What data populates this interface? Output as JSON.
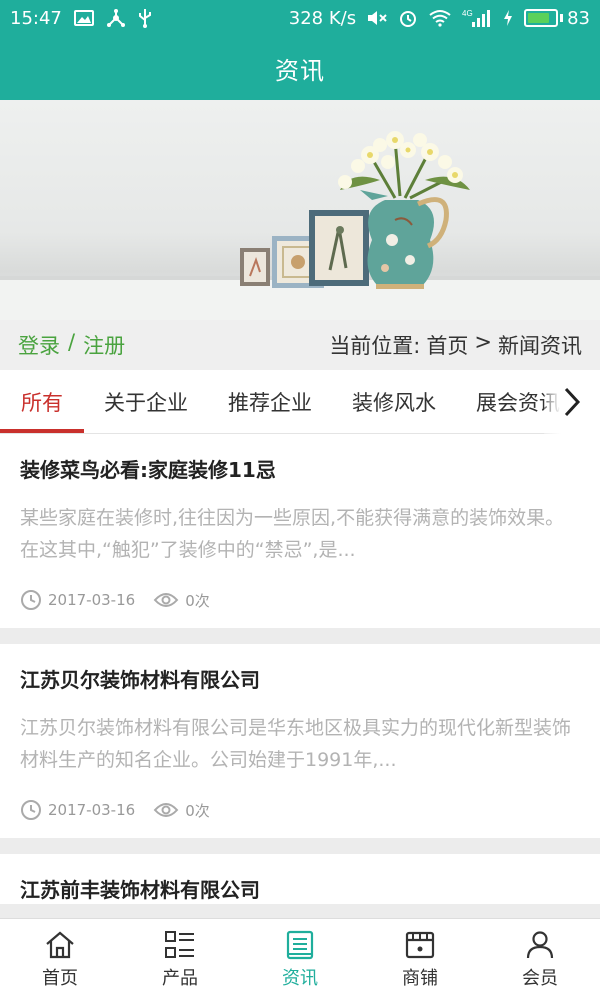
{
  "status_bar": {
    "time": "15:47",
    "net_speed": "328 K/s",
    "network_type": "4G",
    "battery": "83",
    "battery_level": 0.83,
    "icons": [
      "photo-icon",
      "usb-share-icon",
      "usb-icon",
      "mute-icon",
      "alarm-icon",
      "wifi-icon",
      "signal-icon",
      "charging-icon"
    ]
  },
  "header": {
    "title": "资讯"
  },
  "banner": {
    "image": "vase-with-flowers-and-frames"
  },
  "locbar": {
    "login": "登录",
    "separator": "/",
    "register": "注册",
    "location_label": "当前位置:",
    "crumb_home": "首页",
    "crumb_sep": ">",
    "crumb_current": "新闻资讯"
  },
  "tabs": [
    {
      "label": "所有",
      "active": true
    },
    {
      "label": "关于企业",
      "active": false
    },
    {
      "label": "推荐企业",
      "active": false
    },
    {
      "label": "装修风水",
      "active": false
    },
    {
      "label": "展会资讯",
      "active": false
    }
  ],
  "articles": [
    {
      "title": "装修菜鸟必看:家庭装修11忌",
      "summary": "某些家庭在装修时,往往因为一些原因,不能获得满意的装饰效果。在这其中,“触犯”了装修中的“禁忌”,是...",
      "date": "2017-03-16",
      "views": "0次"
    },
    {
      "title": "江苏贝尔装饰材料有限公司",
      "summary": "江苏贝尔装饰材料有限公司是华东地区极具实力的现代化新型装饰材料生产的知名企业。公司始建于1991年,...",
      "date": "2017-03-16",
      "views": "0次"
    },
    {
      "title": "江苏前丰装饰材料有限公司",
      "summary": "",
      "date": "",
      "views": ""
    }
  ],
  "bottom_nav": [
    {
      "label": "首页",
      "icon": "home-icon",
      "active": false
    },
    {
      "label": "产品",
      "icon": "list-icon",
      "active": false
    },
    {
      "label": "资讯",
      "icon": "news-icon",
      "active": true
    },
    {
      "label": "商铺",
      "icon": "shop-icon",
      "active": false
    },
    {
      "label": "会员",
      "icon": "user-icon",
      "active": false
    }
  ],
  "colors": {
    "primary": "#1fae9c",
    "active_tab": "#c9302c",
    "login": "#4aa33f"
  }
}
